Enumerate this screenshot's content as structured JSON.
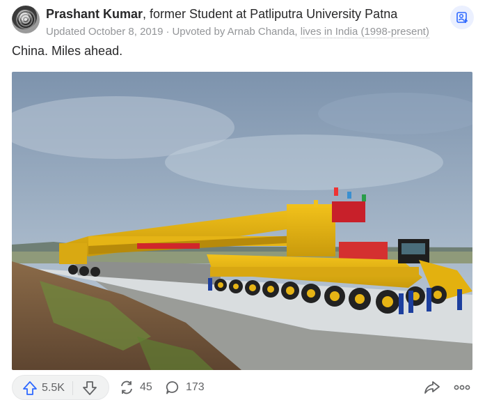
{
  "author": {
    "name": "Prashant Kumar",
    "credential": ", former Student at Patliputra University Patna"
  },
  "meta": {
    "updated": "Updated October 8, 2019",
    "separator": "·",
    "upvoted_by": "Upvoted by Arnab Chanda,",
    "location": "lives in India (1998-present)"
  },
  "answer": {
    "text": "China. Miles ahead."
  },
  "actions": {
    "upvotes": "5.5K",
    "shares": "45",
    "comments": "173"
  },
  "icons": {
    "follow": "follow-person-plus-icon",
    "upvote": "upvote-arrow-icon",
    "downvote": "downvote-arrow-icon",
    "share_count": "reshare-icon",
    "comment": "comment-bubble-icon",
    "share": "share-arrow-icon",
    "more": "more-dots-icon"
  },
  "colors": {
    "accent": "#2e69ff",
    "follow_bg": "#ebf0ff",
    "meta_gray": "#939598"
  }
}
